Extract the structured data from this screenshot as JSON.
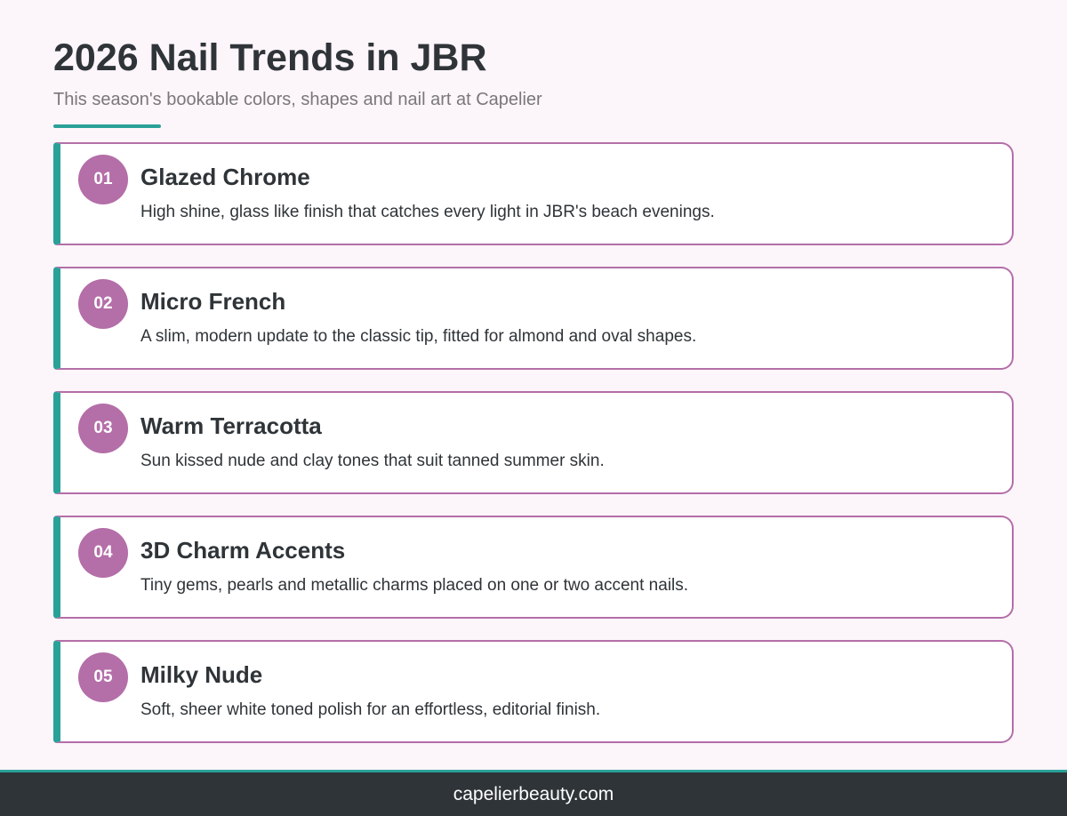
{
  "header": {
    "title": "2026 Nail Trends in JBR",
    "subtitle": "This season's bookable colors, shapes and nail art at Capelier"
  },
  "trends": [
    {
      "number": "01",
      "name": "Glazed Chrome",
      "description": "High shine, glass like finish that catches every light in JBR's beach evenings."
    },
    {
      "number": "02",
      "name": "Micro French",
      "description": "A slim, modern update to the classic tip, fitted for almond and oval shapes."
    },
    {
      "number": "03",
      "name": "Warm Terracotta",
      "description": "Sun kissed nude and clay tones that suit tanned summer skin."
    },
    {
      "number": "04",
      "name": "3D Charm Accents",
      "description": "Tiny gems, pearls and metallic charms placed on one or two accent nails."
    },
    {
      "number": "05",
      "name": "Milky Nude",
      "description": "Soft, sheer white toned polish for an effortless, editorial finish."
    }
  ],
  "footer": {
    "link": "capelierbeauty.com"
  },
  "colors": {
    "background": "#fcf5fa",
    "accent_teal": "#2aa198",
    "accent_mauve": "#b46ea8",
    "text_dark": "#2f3438",
    "text_muted": "#7a7878",
    "footer_bg": "#2f3438"
  }
}
